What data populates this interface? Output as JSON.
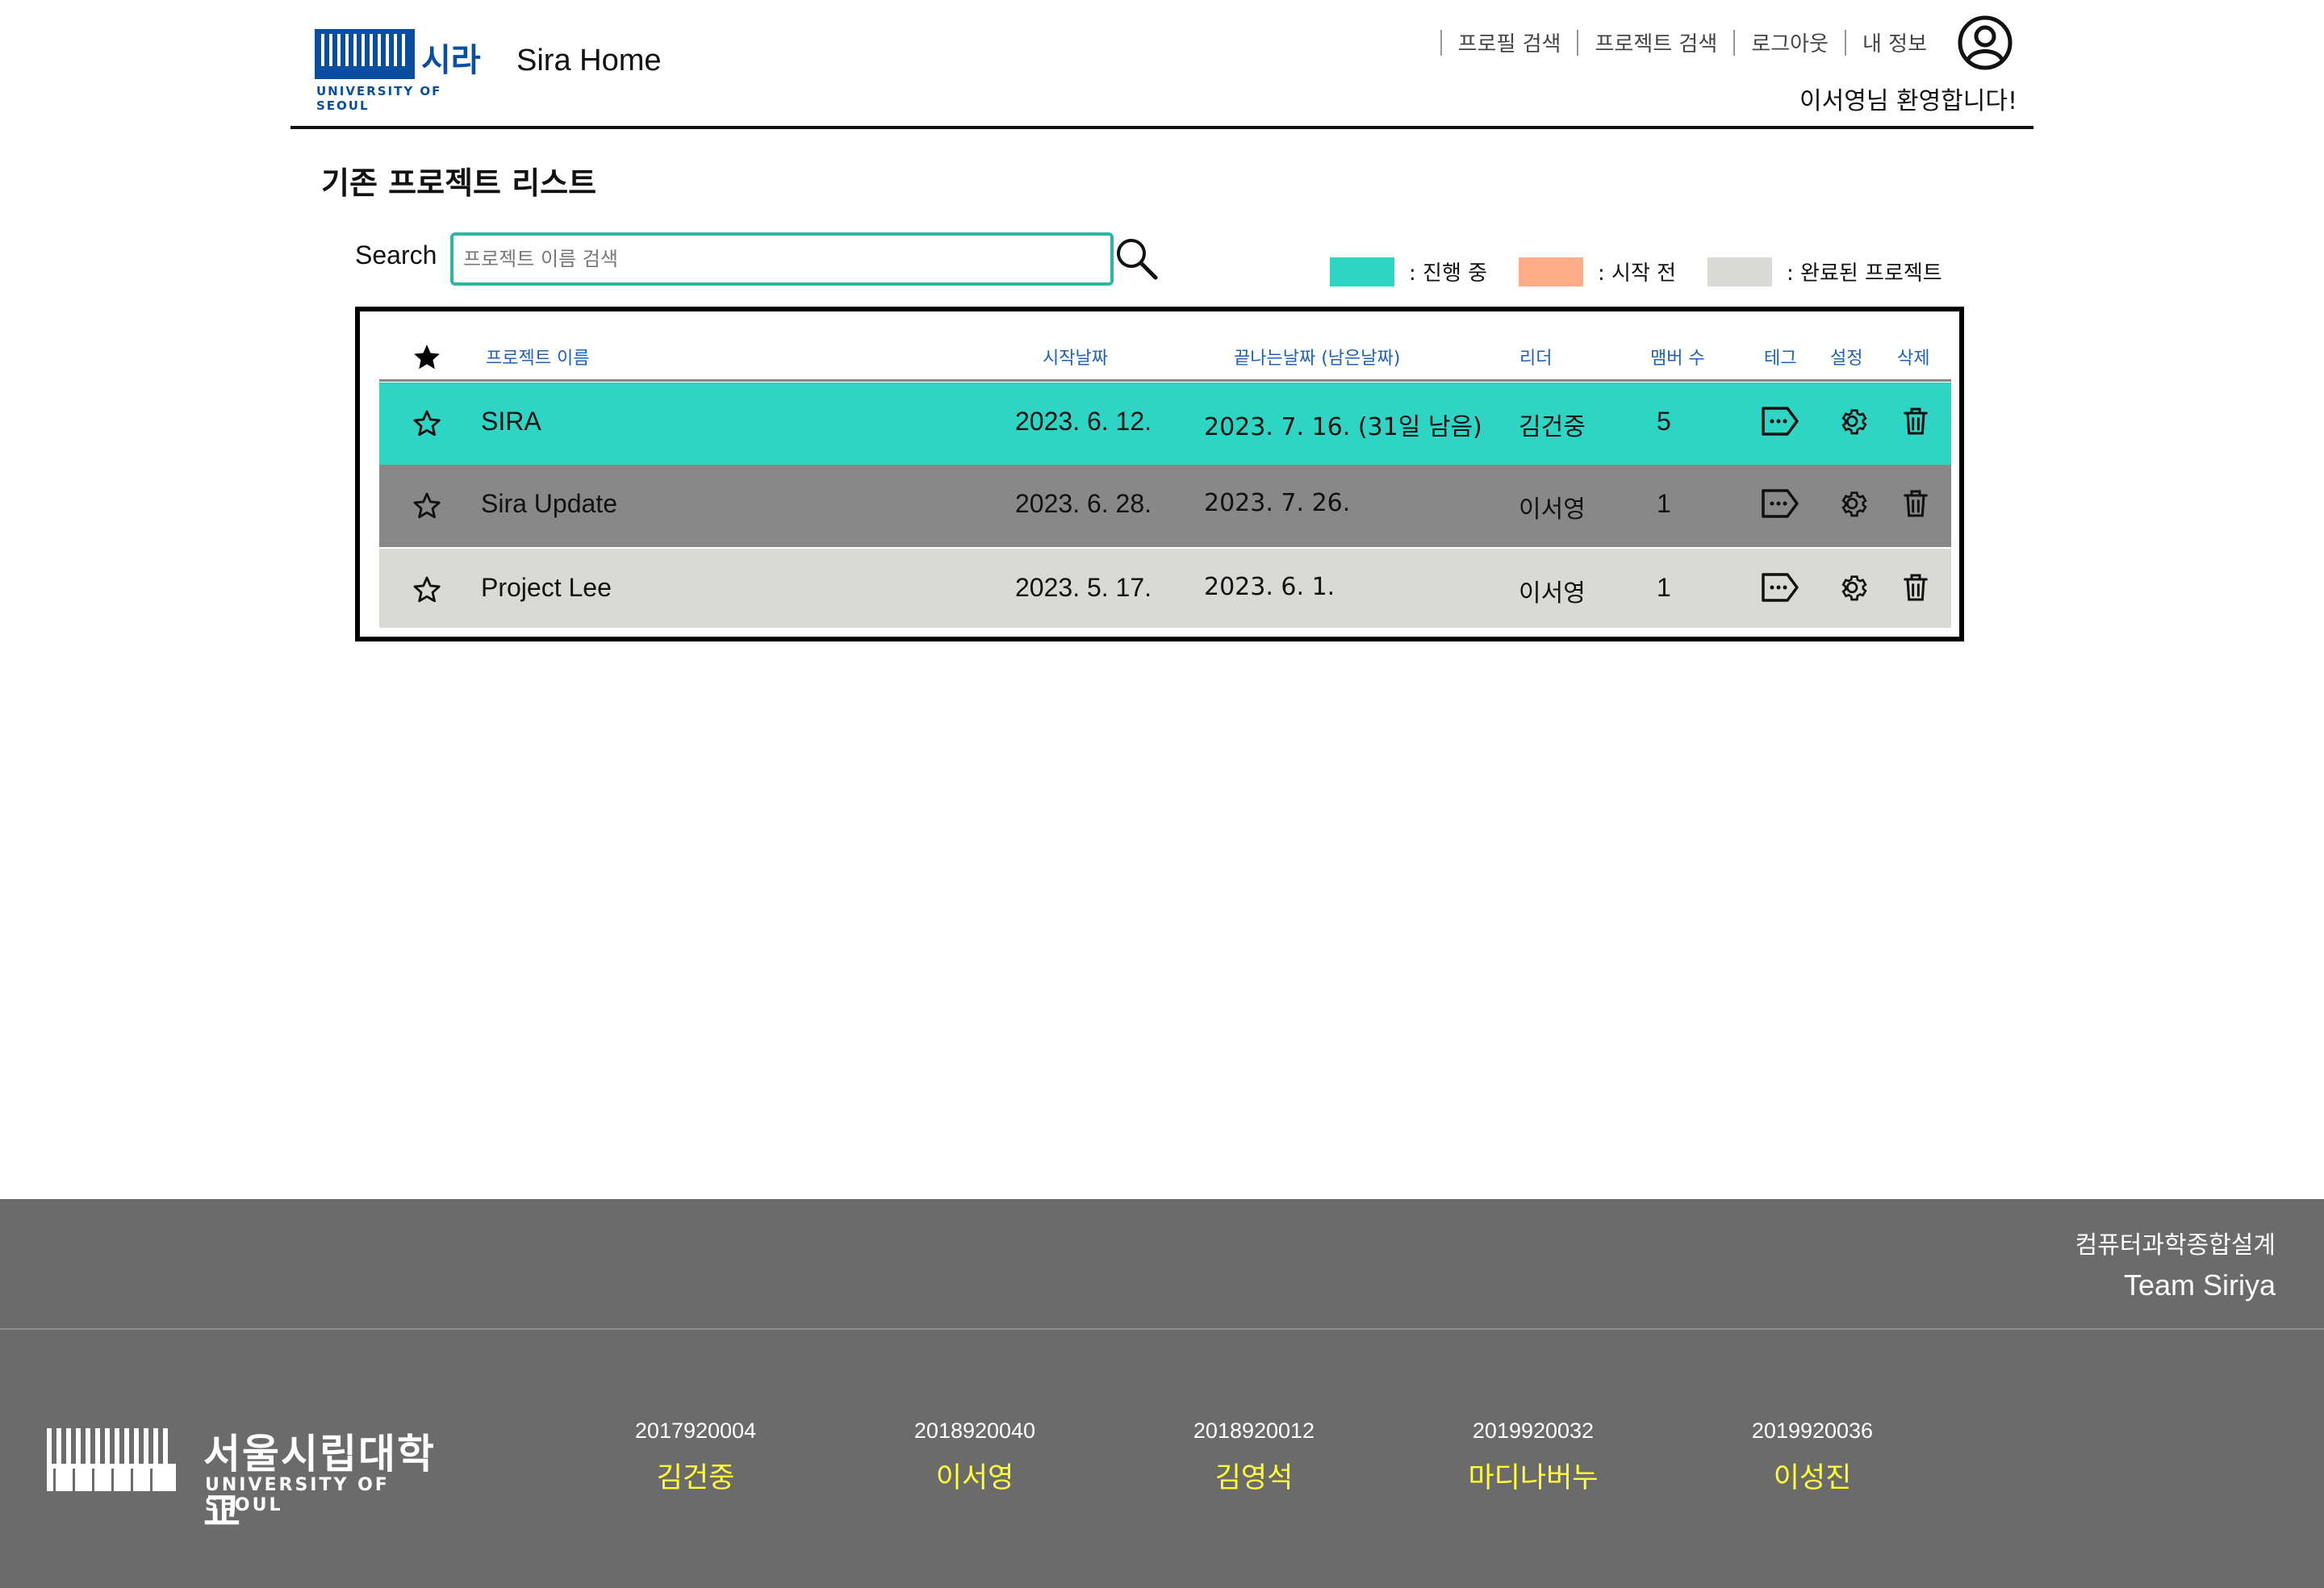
{
  "header": {
    "logo_ko": "시라",
    "logo_en": "UNIVERSITY OF SEOUL",
    "app_title": "Sira Home",
    "nav": [
      "프로필 검색",
      "프로젝트 검색",
      "로그아웃",
      "내 정보"
    ],
    "welcome": "이서영님 환영합니다!"
  },
  "main": {
    "title": "기존 프로젝트 리스트",
    "search_label": "Search",
    "search_placeholder": "프로젝트 이름 검색",
    "legend": [
      {
        "label": ": 진행 중",
        "color": "#2ed4c4"
      },
      {
        "label": ": 시작 전",
        "color": "#fdae86"
      },
      {
        "label": ": 완료된 프로젝트",
        "color": "#d9d9d6"
      }
    ]
  },
  "table": {
    "columns": [
      "프로젝트 이름",
      "시작날짜",
      "끝나는날짜 (남은날짜)",
      "리더",
      "맴버 수",
      "테그",
      "설정",
      "삭제"
    ],
    "rows": [
      {
        "name": "SIRA",
        "start": "2023. 6. 12.",
        "end": "2023. 7. 16. (31일 남음)",
        "leader": "김건중",
        "members": "5",
        "color": "#2ed4c4"
      },
      {
        "name": "Sira Update",
        "start": "2023. 6. 28.",
        "end": "2023. 7. 26.",
        "leader": "이서영",
        "members": "1",
        "color": "#888888"
      },
      {
        "name": "Project Lee",
        "start": "2023. 5. 17.",
        "end": "2023. 6. 1.",
        "leader": "이서영",
        "members": "1",
        "color": "#d9d9d6"
      }
    ]
  },
  "footer": {
    "course": "컴퓨터과학종합설계",
    "team": "Team Siriya",
    "univ_ko": "서울시립대학교",
    "univ_en": "UNIVERSITY OF SEOUL",
    "members": [
      {
        "id": "2017920004",
        "name": "김건중"
      },
      {
        "id": "2018920040",
        "name": "이서영"
      },
      {
        "id": "2018920012",
        "name": "김영석"
      },
      {
        "id": "2019920032",
        "name": "마디나버누"
      },
      {
        "id": "2019920036",
        "name": "이성진"
      }
    ]
  }
}
